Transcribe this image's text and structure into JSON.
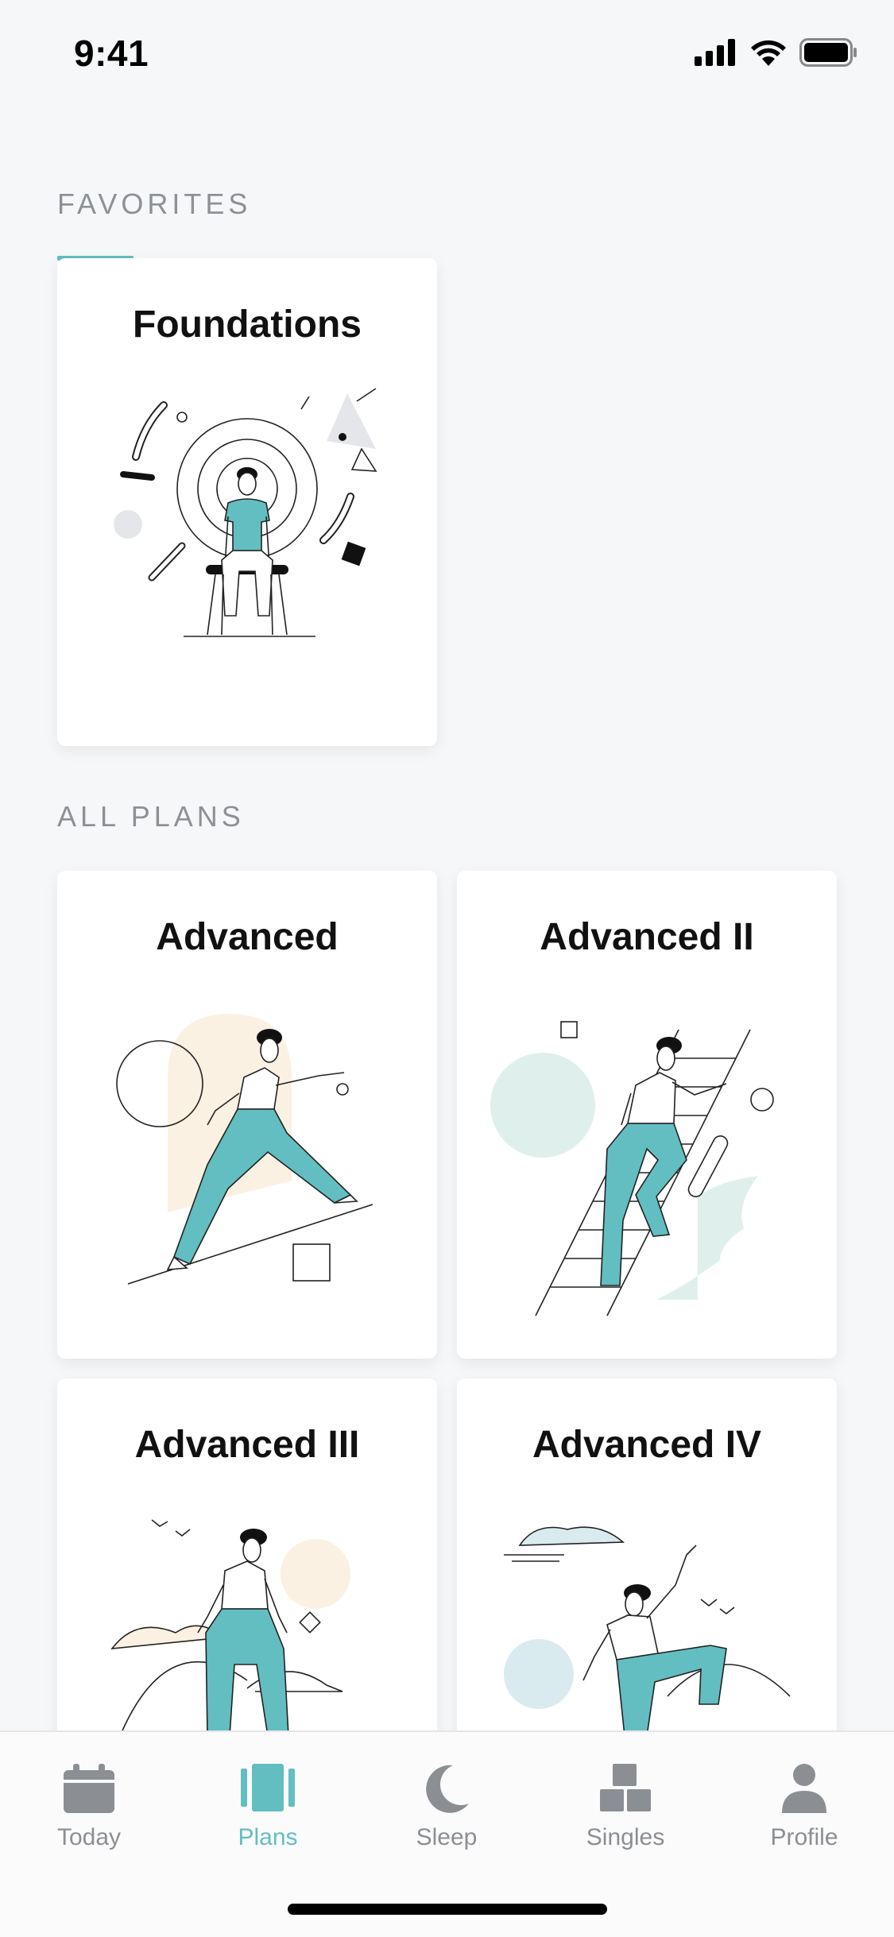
{
  "status_bar": {
    "time": "9:41"
  },
  "sections": {
    "favorites": "FAVORITES",
    "all_plans": "ALL PLANS"
  },
  "favorites": [
    {
      "title": "Foundations"
    }
  ],
  "plans": [
    {
      "title": "Advanced"
    },
    {
      "title": "Advanced II"
    },
    {
      "title": "Advanced III"
    },
    {
      "title": "Advanced IV"
    }
  ],
  "tabs": [
    {
      "label": "Today",
      "icon": "calendar-icon"
    },
    {
      "label": "Plans",
      "icon": "plans-icon",
      "active": true
    },
    {
      "label": "Sleep",
      "icon": "moon-icon"
    },
    {
      "label": "Singles",
      "icon": "blocks-icon"
    },
    {
      "label": "Profile",
      "icon": "person-icon"
    }
  ],
  "colors": {
    "accent": "#62bec1",
    "background": "#f6f7f9",
    "inactive_tab": "#8b8f94",
    "illustration_peach": "#fbf1e2",
    "illustration_mint": "#dff0ec",
    "illustration_blue": "#d9ebee"
  }
}
